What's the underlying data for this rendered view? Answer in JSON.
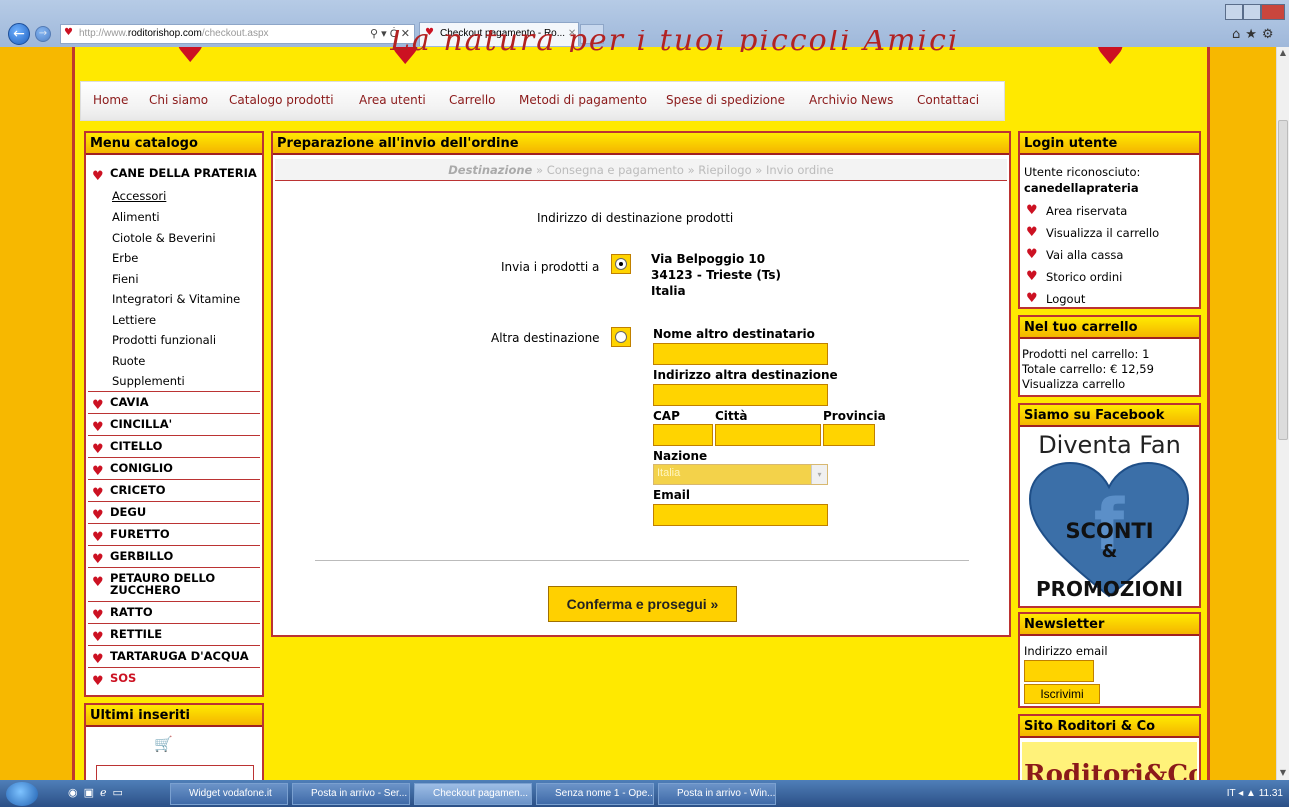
{
  "browser": {
    "url_prefix": "http://www.",
    "url_host": "roditorishop.com",
    "url_suffix": "/checkout.aspx",
    "addr_icons": "⚲ ▾ Ċ ✕",
    "tab_title": "Checkout pagamento - Ro...",
    "tab_close": "✕",
    "back_glyph": "←",
    "fwd_glyph": "→",
    "right_icons": "⌂★⚙"
  },
  "banner": {
    "text": "La natura per i tuoi piccoli Amici"
  },
  "nav": {
    "items": [
      "Home",
      "Chi siamo",
      "Catalogo prodotti",
      "Area utenti",
      "Carrello",
      "Metodi di pagamento",
      "Spese di spedizione",
      "Archivio News",
      "Contattaci"
    ]
  },
  "left": {
    "title": "Menu catalogo",
    "top_category": "CANE DELLA PRATERIA",
    "subcategories": [
      "Accessori",
      "Alimenti",
      "Ciotole & Beverini",
      "Erbe",
      "Fieni",
      "Integratori & Vitamine",
      "Lettiere",
      "Prodotti funzionali",
      "Ruote",
      "Supplementi"
    ],
    "categories": [
      "CAVIA",
      "CINCILLA'",
      "CITELLO",
      "CONIGLIO",
      "CRICETO",
      "DEGU",
      "FURETTO",
      "GERBILLO",
      "PETAURO DELLO ZUCCHERO",
      "RATTO",
      "RETTILE",
      "TARTARUGA D'ACQUA",
      "SOS"
    ],
    "latest_title": "Ultimi inseriti"
  },
  "center": {
    "title": "Preparazione all'invio dell'ordine",
    "steps": {
      "current": "Destinazione",
      "rest": " » Consegna e pagamento » Riepilogo » Invio ordine"
    },
    "heading": "Indirizzo di destinazione prodotti",
    "send_to_label": "Invia i prodotti a",
    "address_line1": "Via Belpoggio 10",
    "address_line2": "34123 - Trieste (Ts)",
    "address_line3": "Italia",
    "alt_label": "Altra destinazione",
    "field_name": "Nome altro destinatario",
    "field_address": "Indirizzo altra destinazione",
    "field_cap": "CAP",
    "field_city": "Città",
    "field_province": "Provincia",
    "field_country": "Nazione",
    "country_value": "Italia",
    "field_email": "Email",
    "confirm_button": "Conferma e prosegui »"
  },
  "login": {
    "title": "Login utente",
    "recognized": "Utente riconosciuto:",
    "username": "canedellaprateria",
    "links": [
      "Area riservata",
      "Visualizza il carrello",
      "Vai alla cassa",
      "Storico ordini",
      "Logout"
    ]
  },
  "cart": {
    "title": "Nel tuo carrello",
    "products": "Prodotti nel carrello: 1",
    "total": "Totale carrello: € 12,59",
    "view": "Visualizza carrello"
  },
  "facebook": {
    "title": "Siamo su Facebook",
    "line1": "Diventa Fan",
    "line2": "SCONTI",
    "line3": "&",
    "line4": "PROMOZIONI"
  },
  "newsletter": {
    "title": "Newsletter",
    "email_label": "Indirizzo email",
    "subscribe": "Iscrivimi"
  },
  "sito": {
    "title": "Sito Roditori & Co",
    "logo_text": "Roditori&Co"
  },
  "taskbar": {
    "buttons": [
      "Widget vodafone.it",
      "Posta in arrivo - Ser...",
      "Checkout pagamen...",
      "Senza nome 1 - Ope...",
      "Posta in arrivo - Win..."
    ],
    "tray": "IT  ◂ ▲  11.31"
  },
  "colors": {
    "accent_red": "#cc1122",
    "page_yellow": "#f7b800",
    "input_yellow": "#ffd400"
  }
}
